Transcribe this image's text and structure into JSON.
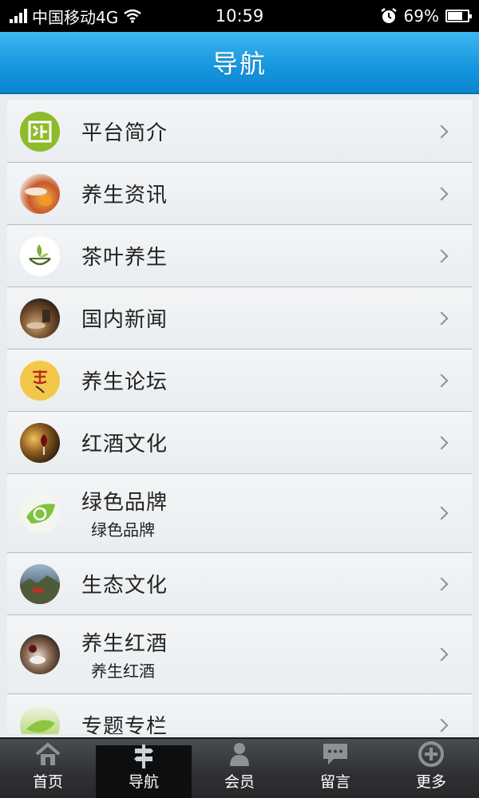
{
  "status_bar": {
    "carrier": "中国移动4G",
    "time": "10:59",
    "battery": "69%"
  },
  "header": {
    "title": "导航"
  },
  "nav_items": [
    {
      "title": "平台简介",
      "subtitle": "",
      "icon": "logo-icon"
    },
    {
      "title": "养生资讯",
      "subtitle": "",
      "icon": "teacup-photo-icon"
    },
    {
      "title": "茶叶养生",
      "subtitle": "",
      "icon": "tea-leaf-cup-icon"
    },
    {
      "title": "国内新闻",
      "subtitle": "",
      "icon": "news-photo-icon"
    },
    {
      "title": "养生论坛",
      "subtitle": "",
      "icon": "calligraphy-icon"
    },
    {
      "title": "红酒文化",
      "subtitle": "",
      "icon": "red-wine-photo-icon"
    },
    {
      "title": "绿色品牌",
      "subtitle": "绿色品牌",
      "icon": "green-recycle-icon"
    },
    {
      "title": "生态文化",
      "subtitle": "",
      "icon": "landscape-photo-icon"
    },
    {
      "title": "养生红酒",
      "subtitle": "养生红酒",
      "icon": "wine-table-photo-icon"
    },
    {
      "title": "专题专栏",
      "subtitle": "",
      "icon": "green-leaf-icon"
    }
  ],
  "tabs": [
    {
      "label": "首页",
      "icon": "home-icon",
      "active": false
    },
    {
      "label": "导航",
      "icon": "signpost-icon",
      "active": true
    },
    {
      "label": "会员",
      "icon": "user-icon",
      "active": false
    },
    {
      "label": "留言",
      "icon": "chat-bubble-icon",
      "active": false
    },
    {
      "label": "更多",
      "icon": "plus-circle-icon",
      "active": false
    }
  ]
}
